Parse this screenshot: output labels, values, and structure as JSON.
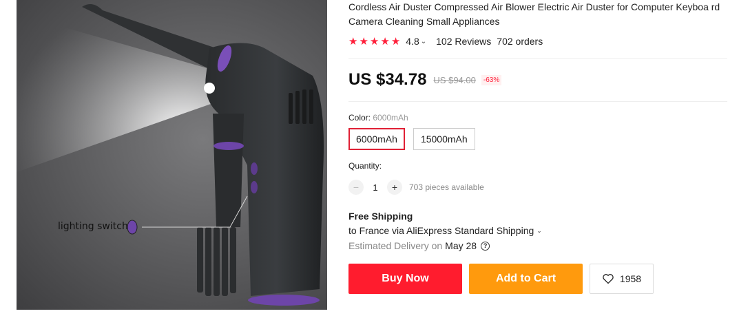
{
  "gallery": {
    "callout_label": "lighting switch"
  },
  "product": {
    "title": "Cordless Air Duster Compressed Air Blower Electric Air Duster for Computer Keyboa rd Camera Cleaning Small Appliances",
    "rating": "4.8",
    "rating_stars": 5,
    "reviews": "102 Reviews",
    "orders": "702 orders"
  },
  "price": {
    "current": "US $34.78",
    "original": "US $94.00",
    "discount": "-63%"
  },
  "color": {
    "label": "Color:",
    "selected": "6000mAh",
    "options": [
      "6000mAh",
      "15000mAh"
    ]
  },
  "quantity": {
    "label": "Quantity:",
    "minus": "−",
    "value": "1",
    "plus": "+",
    "available": "703 pieces available"
  },
  "shipping": {
    "title": "Free Shipping",
    "line": "to France via AliExpress Standard Shipping",
    "estimated_label": "Estimated Delivery on",
    "date": "May 28",
    "help": "?"
  },
  "actions": {
    "buy_now": "Buy Now",
    "add_to_cart": "Add to Cart",
    "wishlist_count": "1958"
  },
  "colors": {
    "accent_red": "#ff1c2e",
    "accent_orange": "#ff9a0d",
    "star": "#ff1f3a"
  }
}
